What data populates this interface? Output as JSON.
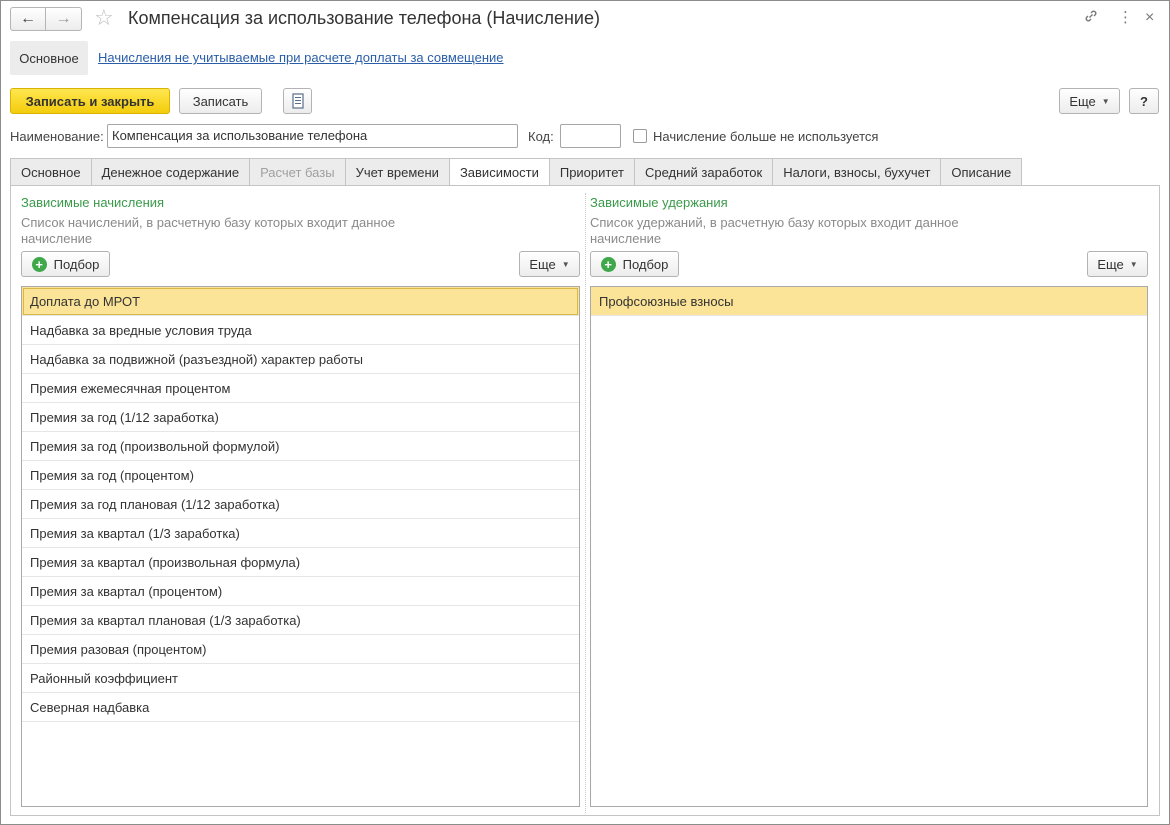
{
  "window": {
    "title": "Компенсация за использование телефона (Начисление)",
    "icons": [
      "back-arrow-icon",
      "forward-arrow-icon",
      "star-icon",
      "link-icon",
      "more-vertical-icon",
      "close-icon"
    ]
  },
  "subnav": {
    "active": "Основное",
    "link": "Начисления не учитываемые при расчете доплаты за совмещение"
  },
  "toolbar": {
    "save_close": "Записать и закрыть",
    "save": "Записать",
    "more": "Еще",
    "help": "?"
  },
  "form": {
    "name_label": "Наименование:",
    "name_value": "Компенсация за использование телефона",
    "code_label": "Код:",
    "code_value": "",
    "not_used_label": "Начисление больше не используется"
  },
  "tabs": [
    {
      "label": "Основное",
      "state": "normal"
    },
    {
      "label": "Денежное содержание",
      "state": "normal"
    },
    {
      "label": "Расчет базы",
      "state": "disabled"
    },
    {
      "label": "Учет времени",
      "state": "normal"
    },
    {
      "label": "Зависимости",
      "state": "active"
    },
    {
      "label": "Приоритет",
      "state": "normal"
    },
    {
      "label": "Средний заработок",
      "state": "normal"
    },
    {
      "label": "Налоги, взносы, бухучет",
      "state": "normal"
    },
    {
      "label": "Описание",
      "state": "normal"
    }
  ],
  "left_group": {
    "title": "Зависимые начисления",
    "description": "Список начислений, в расчетную базу которых входит данное начисление",
    "pick_button": "Подбор",
    "more_button": "Еще",
    "items": [
      "Доплата до МРОТ",
      "Надбавка за вредные условия труда",
      "Надбавка за подвижной (разъездной) характер работы",
      "Премия ежемесячная процентом",
      "Премия за год (1/12 заработка)",
      "Премия за год (произвольной формулой)",
      "Премия за год (процентом)",
      "Премия за год плановая (1/12 заработка)",
      "Премия за квартал (1/3 заработка)",
      "Премия за квартал (произвольная формула)",
      "Премия за квартал (процентом)",
      "Премия за квартал плановая (1/3 заработка)",
      "Премия разовая (процентом)",
      "Районный коэффициент",
      "Северная надбавка"
    ]
  },
  "right_group": {
    "title": "Зависимые удержания",
    "description": "Список удержаний, в расчетную базу которых входит данное начисление",
    "pick_button": "Подбор",
    "more_button": "Еще",
    "items": [
      "Профсоюзные взносы"
    ]
  },
  "colors": {
    "primary_button": "#f4cc0c",
    "selected_row": "#fbe498",
    "group_title": "#3a9a4a",
    "link": "#2a5ea8"
  }
}
